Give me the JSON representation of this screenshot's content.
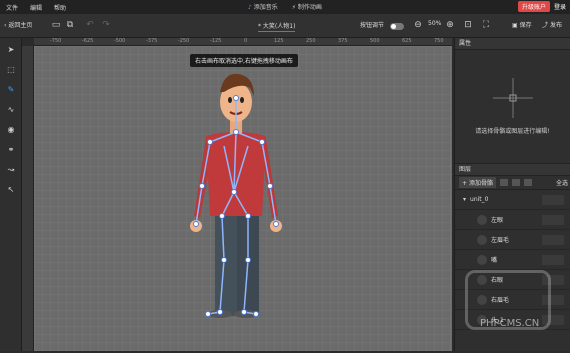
{
  "menu": [
    "文件",
    "编辑",
    "帮助"
  ],
  "topbar": {
    "add_music": "添加音乐",
    "make_animation": "制作动画",
    "upgrade": "升级账户",
    "login": "登录"
  },
  "toolbar": {
    "back": "返回主页",
    "file_title": "* 大笑(人物1)",
    "snap_label": "按钮调节",
    "zoom": "50%",
    "save": "保存",
    "publish": "发布"
  },
  "ruler_ticks": [
    "-750",
    "-625",
    "-500",
    "-375",
    "-250",
    "-125",
    "0",
    "125",
    "250",
    "375",
    "500",
    "625",
    "750"
  ],
  "canvas": {
    "tooltip": "右击画布取消选中,右键拖拽移动画布"
  },
  "properties": {
    "title": "属性",
    "hint": "请选择骨骼或图层进行编辑!"
  },
  "layers": {
    "title": "图层",
    "add_bone": "添加骨骼",
    "select_all": "全选",
    "root": "unit_0",
    "items": [
      "左眼",
      "左眉毛",
      "嘴",
      "右眼",
      "右眉毛",
      "",
      "头_1"
    ]
  },
  "watermark": "PHPCMS.CN"
}
